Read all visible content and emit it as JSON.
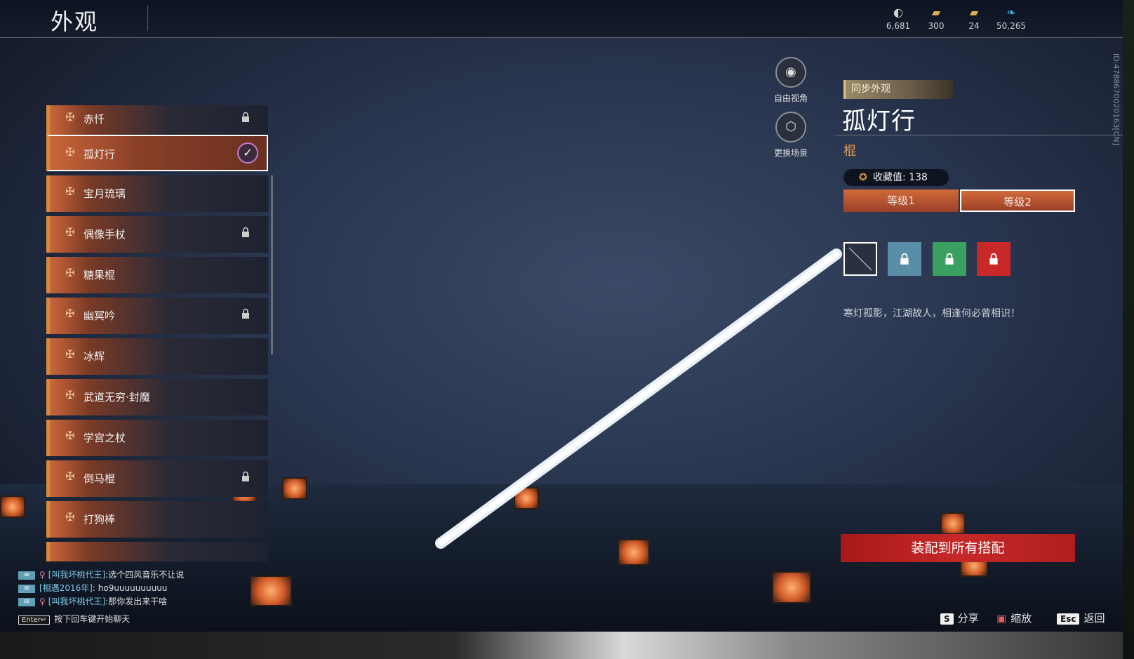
{
  "header": {
    "title": "外观",
    "currencies": [
      {
        "icon": "mask-currency-icon",
        "glyph": "◐",
        "value": "6,681",
        "color": "#d0d0d0"
      },
      {
        "icon": "gold-ticket-icon",
        "glyph": "▰",
        "value": "300",
        "color": "#e0b050"
      },
      {
        "icon": "gold-ticket-plus-icon",
        "glyph": "▰",
        "value": "24",
        "color": "#e0b050"
      },
      {
        "icon": "feather-icon",
        "glyph": "❧",
        "value": "50,265",
        "color": "#4aa8d8"
      }
    ]
  },
  "list": {
    "items": [
      {
        "label": "赤忏",
        "locked": true
      },
      {
        "label": "孤灯行",
        "locked": false,
        "selected": true
      },
      {
        "label": "宝月琉璃",
        "locked": false
      },
      {
        "label": "偶像手杖",
        "locked": true
      },
      {
        "label": "糖果棍",
        "locked": false
      },
      {
        "label": "幽冥吟",
        "locked": true
      },
      {
        "label": "冰辉",
        "locked": false
      },
      {
        "label": "武道无穷·封魔",
        "locked": false
      },
      {
        "label": "学宫之杖",
        "locked": false
      },
      {
        "label": "倒马棍",
        "locked": true
      },
      {
        "label": "打狗棒",
        "locked": false
      }
    ]
  },
  "tools": {
    "free_view": "自由视角",
    "change_scene": "更换场景"
  },
  "detail": {
    "sync_tag": "同步外观",
    "name": "孤灯行",
    "type": "棍",
    "collect_label": "收藏值: 138",
    "levels": [
      "等级1",
      "等级2"
    ],
    "active_level": 1,
    "swatch_colors": [
      "#2a3040",
      "#5a8ea8",
      "#3aa060",
      "#c82828"
    ],
    "description": "寒灯孤影，江湖故人，相逢何必曾相识！",
    "equip_button": "装配到所有搭配"
  },
  "hints": {
    "share_key": "S",
    "share_label": "分享",
    "zoom_label": "缩放",
    "back_key": "Esc",
    "back_label": "返回"
  },
  "chat": {
    "lines": [
      {
        "name": "[叫我坏桃代王]",
        "text": ":选个四风音乐不让说",
        "female": true
      },
      {
        "name": "[相遇2016年]",
        "text": ": ho9uuuuuuuuuu",
        "female": false
      },
      {
        "name": "[叫我坏桃代王]",
        "text": ":那你发出来干啥",
        "female": true
      }
    ],
    "enter_key": "Enter↵",
    "hint": "按下回车键开始聊天"
  },
  "player_id": "ID:4788670020163[CN]"
}
